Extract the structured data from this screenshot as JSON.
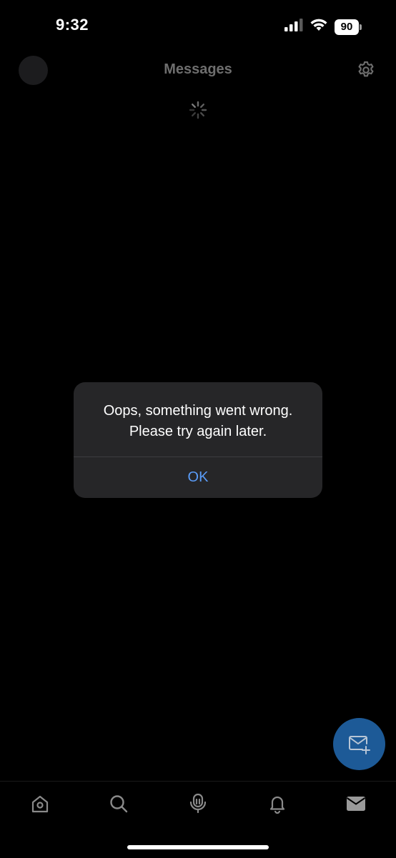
{
  "status_bar": {
    "time": "9:32",
    "battery": "90",
    "icons": [
      "cellular-signal-icon",
      "wifi-icon",
      "battery-icon"
    ]
  },
  "header": {
    "title": "Messages",
    "avatar_icon": "avatar",
    "settings_icon": "gear-icon"
  },
  "loading_icon": "spinner-icon",
  "alert": {
    "message": "Oops, something went wrong. Please try again later.",
    "ok_label": "OK",
    "button_color": "#5a9cf8"
  },
  "fab": {
    "icon": "new-message-icon",
    "color": "#1d5a97"
  },
  "bottom_nav": {
    "items": [
      {
        "icon": "home-icon"
      },
      {
        "icon": "search-icon"
      },
      {
        "icon": "spaces-icon"
      },
      {
        "icon": "bell-icon"
      },
      {
        "icon": "mail-icon",
        "active": true
      }
    ]
  }
}
